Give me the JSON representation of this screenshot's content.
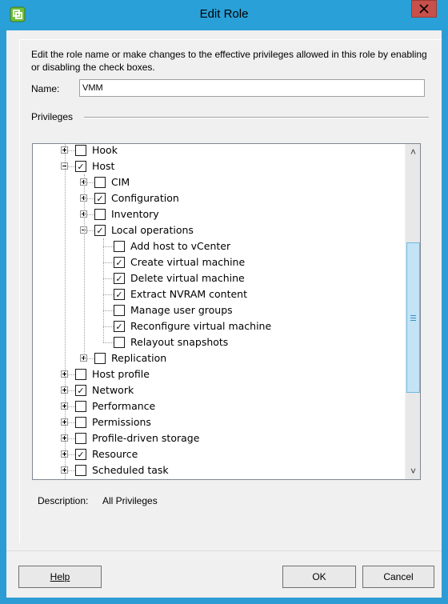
{
  "window": {
    "title": "Edit Role",
    "icon": "vsphere-client-icon",
    "close_icon": "close-icon",
    "accent_color": "#29a0d8",
    "close_color": "#c7504a"
  },
  "intro_text": "Edit the role name or make changes to the effective privileges allowed in this role by enabling or disabling the check boxes.",
  "name_field": {
    "label": "Name:",
    "value": "VMM"
  },
  "privileges_label": "Privileges",
  "tree": {
    "items": [
      {
        "label": "Hook",
        "level": 0,
        "expander": "plus",
        "checked": false
      },
      {
        "label": "Host",
        "level": 0,
        "expander": "minus",
        "checked": true
      },
      {
        "label": "CIM",
        "level": 1,
        "expander": "plus",
        "checked": false
      },
      {
        "label": "Configuration",
        "level": 1,
        "expander": "plus",
        "checked": true
      },
      {
        "label": "Inventory",
        "level": 1,
        "expander": "plus",
        "checked": false
      },
      {
        "label": "Local operations",
        "level": 1,
        "expander": "minus",
        "checked": true
      },
      {
        "label": "Add host to vCenter",
        "level": 2,
        "expander": "none",
        "checked": false
      },
      {
        "label": "Create virtual machine",
        "level": 2,
        "expander": "none",
        "checked": true
      },
      {
        "label": "Delete virtual machine",
        "level": 2,
        "expander": "none",
        "checked": true
      },
      {
        "label": "Extract NVRAM content",
        "level": 2,
        "expander": "none",
        "checked": true
      },
      {
        "label": "Manage user groups",
        "level": 2,
        "expander": "none",
        "checked": false
      },
      {
        "label": "Reconfigure virtual machine",
        "level": 2,
        "expander": "none",
        "checked": true
      },
      {
        "label": "Relayout snapshots",
        "level": 2,
        "expander": "none",
        "checked": false
      },
      {
        "label": "Replication",
        "level": 1,
        "expander": "plus",
        "checked": false
      },
      {
        "label": "Host profile",
        "level": 0,
        "expander": "plus",
        "checked": false
      },
      {
        "label": "Network",
        "level": 0,
        "expander": "plus",
        "checked": true
      },
      {
        "label": "Performance",
        "level": 0,
        "expander": "plus",
        "checked": false
      },
      {
        "label": "Permissions",
        "level": 0,
        "expander": "plus",
        "checked": false
      },
      {
        "label": "Profile-driven storage",
        "level": 0,
        "expander": "plus",
        "checked": false
      },
      {
        "label": "Resource",
        "level": 0,
        "expander": "plus",
        "checked": true
      },
      {
        "label": "Scheduled task",
        "level": 0,
        "expander": "plus",
        "checked": false
      }
    ],
    "checkmark": "✓"
  },
  "scrollbar": {
    "up_glyph": "˄",
    "down_glyph": "˅",
    "thumb_icon": "scroll-grip-icon"
  },
  "description": {
    "label": "Description:",
    "value": "All Privileges"
  },
  "buttons": {
    "help": "Help",
    "ok": "OK",
    "cancel": "Cancel"
  }
}
